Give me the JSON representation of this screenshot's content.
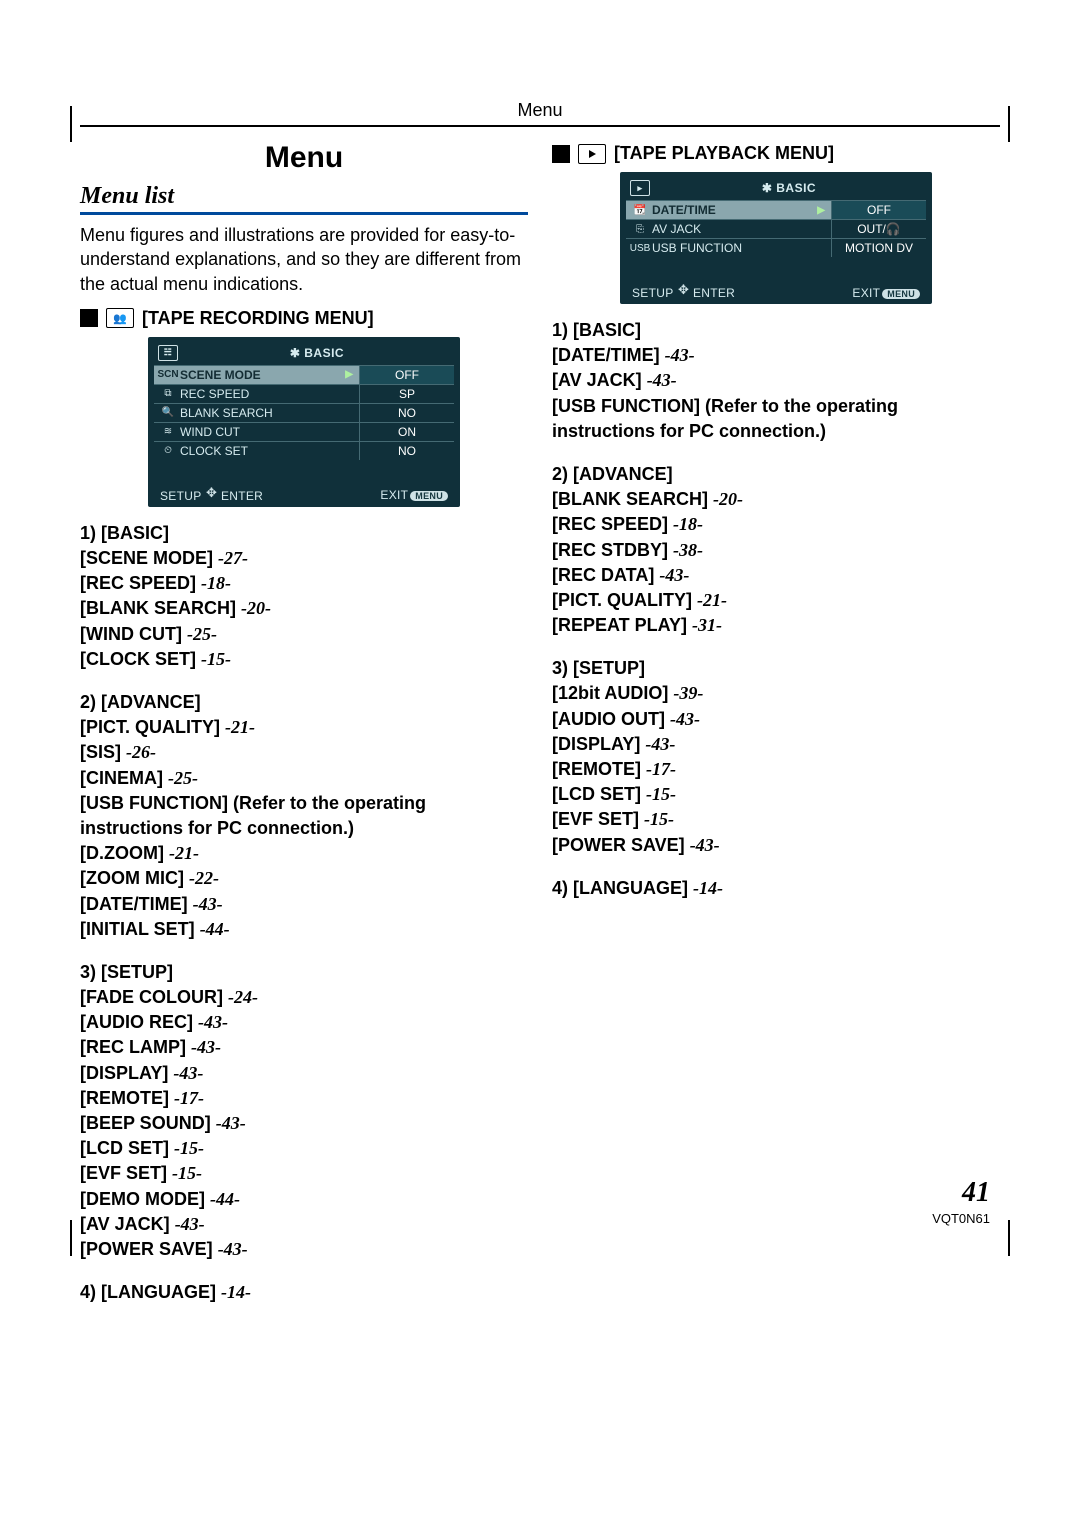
{
  "running_head": "Menu",
  "page_title": "Menu",
  "section_title": "Menu list",
  "intro": "Menu figures and illustrations are provided for easy-to-understand explanations, and so they are different from the actual menu indications.",
  "subhead_recording": "[TAPE RECORDING MENU]",
  "subhead_playback": "[TAPE PLAYBACK MENU]",
  "lcd_recording": {
    "header_icon": "☵",
    "header_title": "BASIC",
    "rows": [
      {
        "icon": "SCN",
        "label": "SCENE MODE",
        "value": "OFF",
        "sel": true
      },
      {
        "icon": "⧉",
        "label": "REC SPEED",
        "value": "SP"
      },
      {
        "icon": "🔍",
        "label": "BLANK SEARCH",
        "value": "NO"
      },
      {
        "icon": "≋",
        "label": "WIND CUT",
        "value": "ON"
      },
      {
        "icon": "⏲",
        "label": "CLOCK SET",
        "value": "NO"
      }
    ],
    "footer_setup": "SETUP",
    "footer_enter": "ENTER",
    "footer_exit": "EXIT",
    "footer_exit_pill": "MENU"
  },
  "lcd_playback": {
    "header_icon": "▸",
    "header_title": "BASIC",
    "rows": [
      {
        "icon": "📆",
        "label": "DATE/TIME",
        "value": "OFF",
        "sel": true
      },
      {
        "icon": "⎘",
        "label": "AV JACK",
        "value": "OUT/🎧"
      },
      {
        "icon": "USB",
        "label": "USB FUNCTION",
        "value": "MOTION DV"
      }
    ],
    "footer_setup": "SETUP",
    "footer_enter": "ENTER",
    "footer_exit": "EXIT",
    "footer_exit_pill": "MENU"
  },
  "rec_groups": [
    {
      "head": "1) [BASIC]",
      "items": [
        {
          "t": "[SCENE MODE]",
          "p": "-27-"
        },
        {
          "t": "[REC SPEED]",
          "p": "-18-"
        },
        {
          "t": "[BLANK SEARCH]",
          "p": "-20-"
        },
        {
          "t": "[WIND CUT]",
          "p": "-25-"
        },
        {
          "t": "[CLOCK SET]",
          "p": "-15-"
        }
      ]
    },
    {
      "head": "2) [ADVANCE]",
      "items": [
        {
          "t": "[PICT. QUALITY]",
          "p": "-21-"
        },
        {
          "t": "[SIS]",
          "p": "-26-"
        },
        {
          "t": "[CINEMA]",
          "p": "-25-"
        },
        {
          "t": "[USB FUNCTION] (Refer to the operating instructions for PC connection.)"
        },
        {
          "t": "[D.ZOOM]",
          "p": "-21-"
        },
        {
          "t": "[ZOOM MIC]",
          "p": "-22-"
        },
        {
          "t": "[DATE/TIME]",
          "p": "-43-"
        },
        {
          "t": "[INITIAL SET]",
          "p": "-44-"
        }
      ]
    },
    {
      "head": "3) [SETUP]",
      "items": [
        {
          "t": "[FADE COLOUR]",
          "p": "-24-"
        },
        {
          "t": "[AUDIO REC]",
          "p": "-43-"
        },
        {
          "t": "[REC LAMP]",
          "p": "-43-"
        },
        {
          "t": "[DISPLAY]",
          "p": "-43-"
        },
        {
          "t": "[REMOTE]",
          "p": "-17-"
        },
        {
          "t": "[BEEP SOUND]",
          "p": "-43-"
        },
        {
          "t": "[LCD SET]",
          "p": "-15-"
        },
        {
          "t": "[EVF SET]",
          "p": "-15-"
        },
        {
          "t": "[DEMO MODE]",
          "p": "-44-"
        },
        {
          "t": "[AV JACK]",
          "p": "-43-"
        },
        {
          "t": "[POWER SAVE]",
          "p": "-43-"
        }
      ]
    },
    {
      "head": "4) [LANGUAGE]",
      "head_page": "-14-"
    }
  ],
  "play_groups": [
    {
      "head": "1) [BASIC]",
      "items": [
        {
          "t": "[DATE/TIME]",
          "p": "-43-"
        },
        {
          "t": "[AV JACK]",
          "p": "-43-"
        },
        {
          "t": "[USB FUNCTION] (Refer to the operating instructions for PC connection.)"
        }
      ]
    },
    {
      "head": "2) [ADVANCE]",
      "items": [
        {
          "t": "[BLANK SEARCH]",
          "p": "-20-"
        },
        {
          "t": "[REC SPEED]",
          "p": "-18-"
        },
        {
          "t": "[REC STDBY]",
          "p": "-38-"
        },
        {
          "t": "[REC DATA]",
          "p": "-43-"
        },
        {
          "t": "[PICT. QUALITY]",
          "p": "-21-"
        },
        {
          "t": "[REPEAT PLAY]",
          "p": "-31-"
        }
      ]
    },
    {
      "head": "3) [SETUP]",
      "items": [
        {
          "t": "[12bit AUDIO]",
          "p": "-39-"
        },
        {
          "t": "[AUDIO OUT]",
          "p": "-43-"
        },
        {
          "t": "[DISPLAY]",
          "p": "-43-"
        },
        {
          "t": "[REMOTE]",
          "p": "-17-"
        },
        {
          "t": "[LCD SET]",
          "p": "-15-"
        },
        {
          "t": "[EVF SET]",
          "p": "-15-"
        },
        {
          "t": "[POWER SAVE]",
          "p": "-43-"
        }
      ]
    },
    {
      "head": "4) [LANGUAGE]",
      "head_page": "-14-"
    }
  ],
  "page_number": "41",
  "doc_code": "VQT0N61"
}
